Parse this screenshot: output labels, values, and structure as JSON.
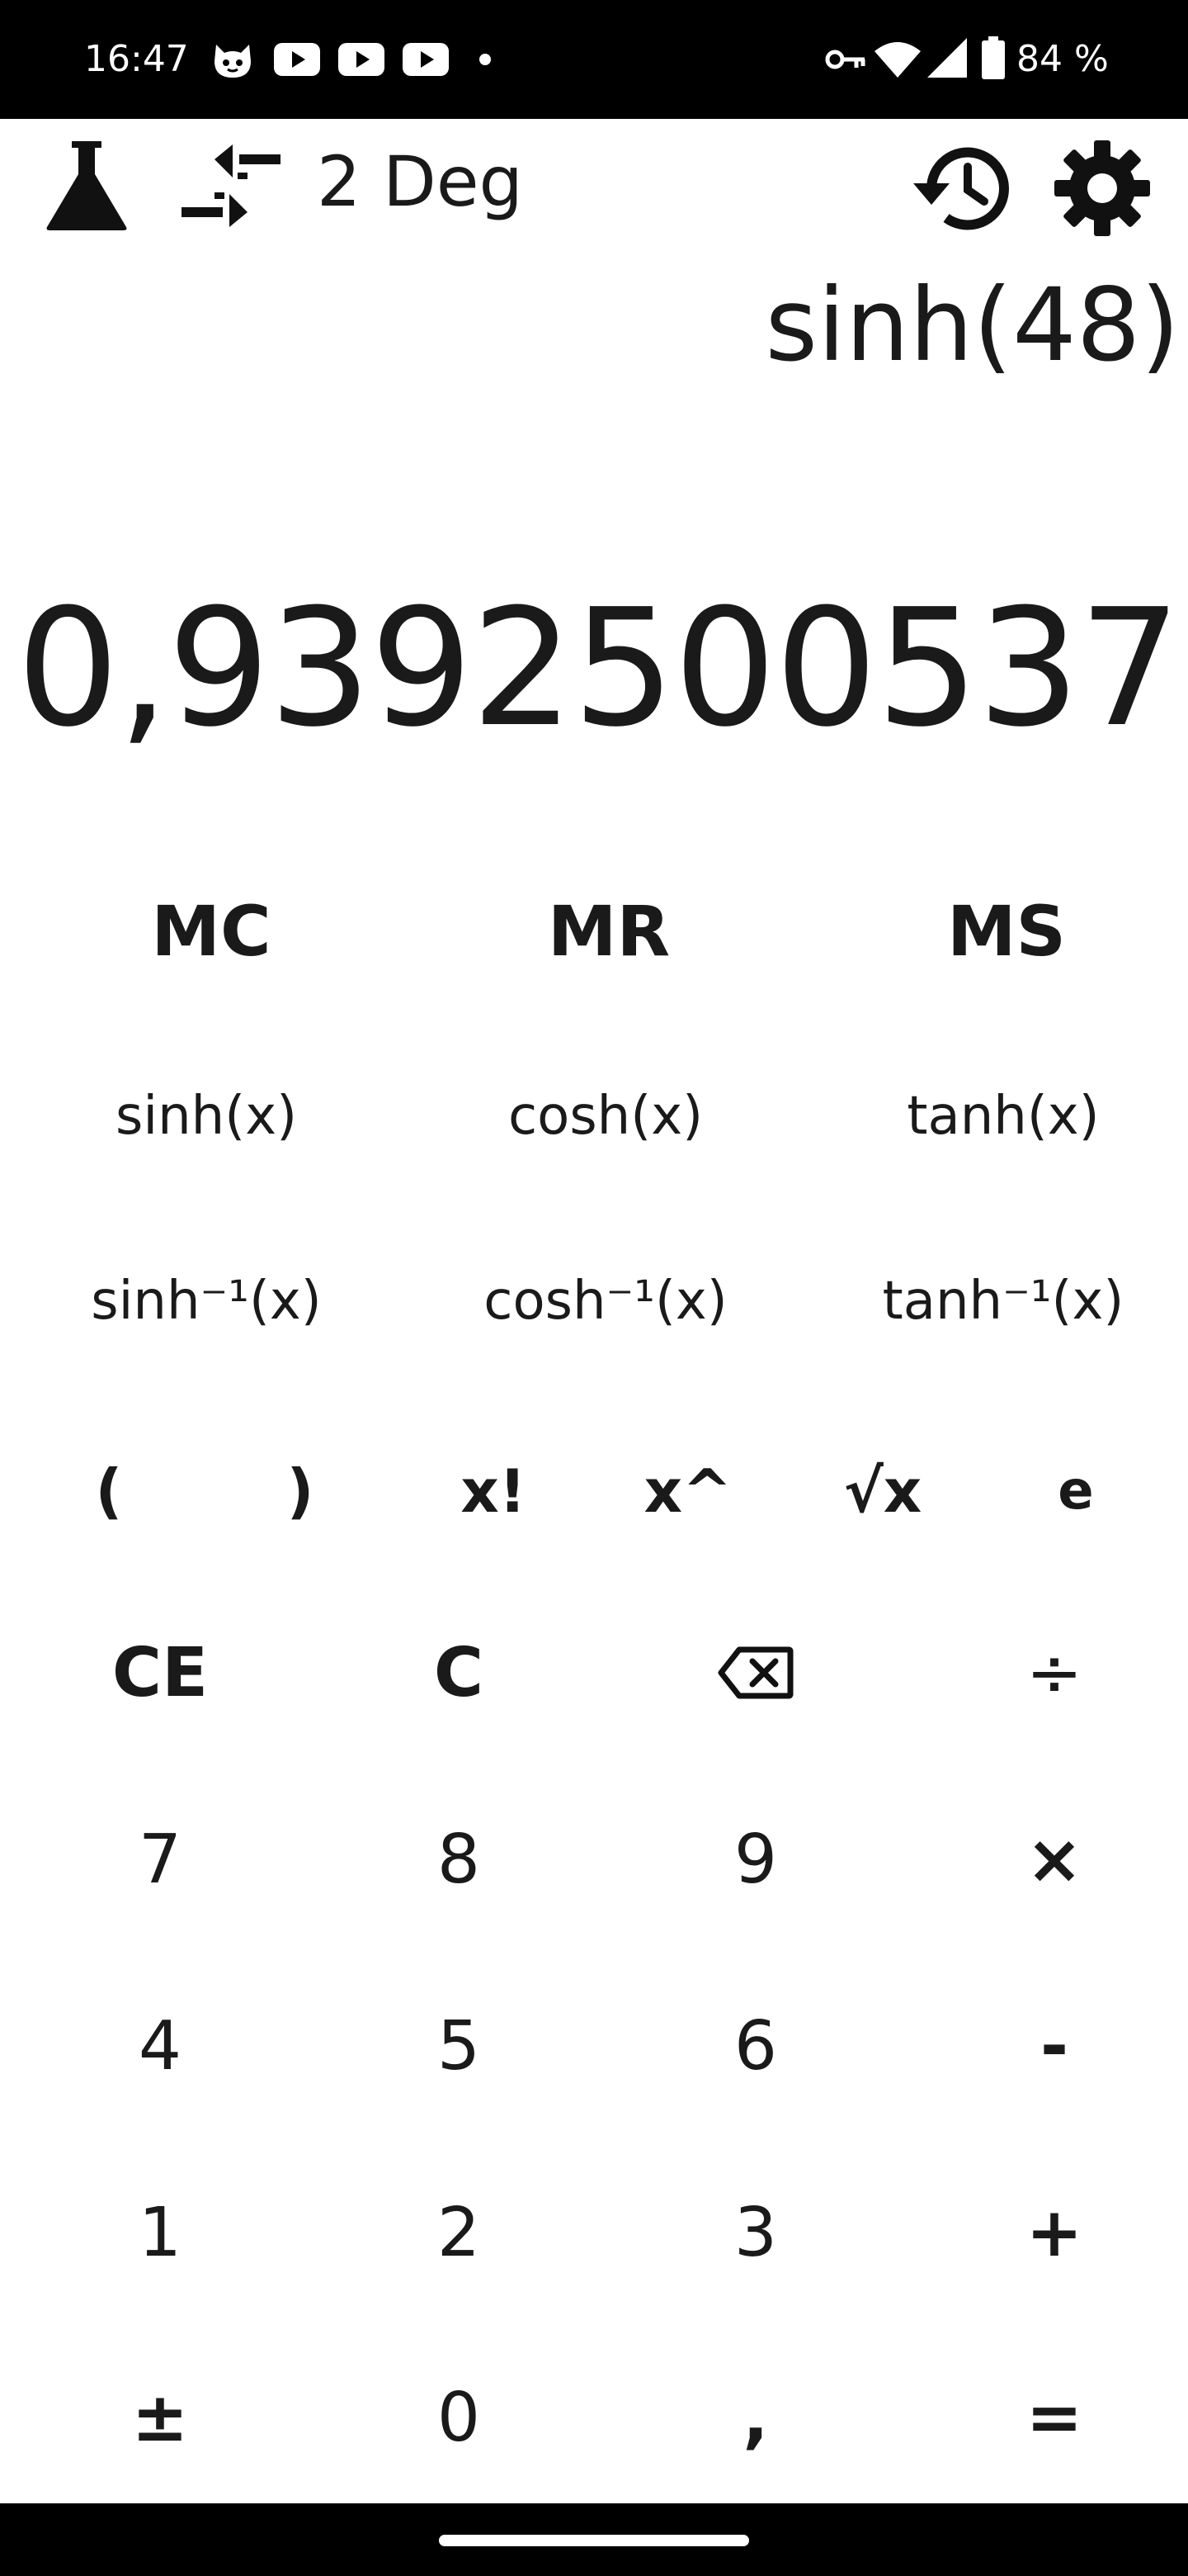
{
  "status_bar": {
    "time": "16:47",
    "battery_text": "84 %",
    "icons": [
      "cat-face-icon",
      "youtube-icon",
      "youtube-icon",
      "youtube-icon",
      "notification-dot-icon",
      "vpn-key-icon",
      "wifi-icon",
      "signal-icon",
      "battery-icon"
    ]
  },
  "toolbar": {
    "mode_icon": "flask-icon",
    "precision_icon": "compress-arrows-icon",
    "precision_text": "2 Deg",
    "history_icon": "history-icon",
    "settings_icon": "gear-icon"
  },
  "display": {
    "expression": "sinh(48)",
    "result": "0,9392500537"
  },
  "memory_row": [
    "MC",
    "MR",
    "MS"
  ],
  "function_rows": [
    [
      "sinh(x)",
      "cosh(x)",
      "tanh(x)"
    ],
    [
      "sinh⁻¹(x)",
      "cosh⁻¹(x)",
      "tanh⁻¹(x)"
    ]
  ],
  "operator_row": [
    "(",
    ")",
    "x!",
    "x^",
    "√x",
    "e"
  ],
  "keypad_rows": [
    [
      "CE",
      "C",
      "backspace",
      "÷"
    ],
    [
      "7",
      "8",
      "9",
      "×"
    ],
    [
      "4",
      "5",
      "6",
      "-"
    ],
    [
      "1",
      "2",
      "3",
      "+"
    ],
    [
      "±",
      "0",
      ",",
      "="
    ]
  ],
  "colors": {
    "background": "#ffffff",
    "text": "#1a1a1a",
    "status_bar": "#000000",
    "nav_bar": "#000000"
  }
}
